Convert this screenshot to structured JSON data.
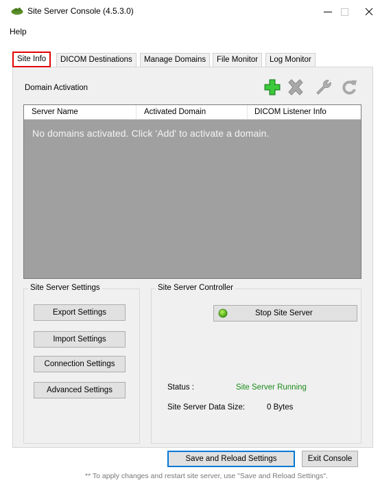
{
  "window": {
    "title": "Site Server Console (4.5.3.0)",
    "minimize_glyph": "—",
    "maximize_glyph": "☐",
    "close_glyph": "✕"
  },
  "menu": {
    "help": "Help"
  },
  "tabs": [
    {
      "label": "Site Info",
      "active": true
    },
    {
      "label": "DICOM Destinations"
    },
    {
      "label": "Manage Domains"
    },
    {
      "label": "File Monitor"
    },
    {
      "label": "Log Monitor"
    }
  ],
  "domain_activation": {
    "label": "Domain Activation",
    "toolbar_icons": [
      "add-icon",
      "remove-icon",
      "wrench-icon",
      "refresh-icon"
    ],
    "columns": [
      "Server Name",
      "Activated Domain",
      "DICOM Listener Info"
    ],
    "empty_message": "No domains activated. Click 'Add' to activate a domain."
  },
  "site_server_settings": {
    "title": "Site Server Settings",
    "buttons": [
      "Export Settings",
      "Import Settings",
      "Connection Settings",
      "Advanced Settings"
    ]
  },
  "site_server_controller": {
    "title": "Site Server Controller",
    "stop_button": "Stop Site Server",
    "status_label": "Status :",
    "status_value": "Site Server Running",
    "data_size_label": "Site Server Data Size:",
    "data_size_value": "0 Bytes"
  },
  "footer": {
    "save_reload": "Save and Reload Settings",
    "exit": "Exit Console",
    "note": "** To apply changes and restart site server, use \"Save and Reload Settings\"."
  },
  "colors": {
    "active_tab_border": "#e00000",
    "status_running": "#1a8a1a",
    "grid_background": "#a0a0a0",
    "focus_border": "#0078d7"
  }
}
